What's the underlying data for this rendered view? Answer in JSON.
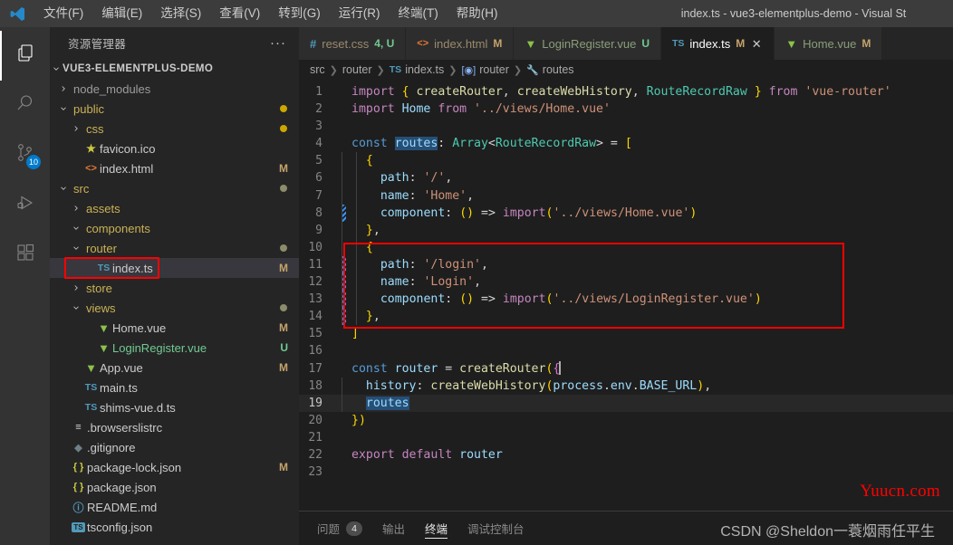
{
  "window": {
    "title": "index.ts - vue3-elementplus-demo - Visual St",
    "logo": "vscode-logo"
  },
  "menu": {
    "items": [
      {
        "label": "文件(F)"
      },
      {
        "label": "编辑(E)"
      },
      {
        "label": "选择(S)"
      },
      {
        "label": "查看(V)"
      },
      {
        "label": "转到(G)"
      },
      {
        "label": "运行(R)"
      },
      {
        "label": "终端(T)"
      },
      {
        "label": "帮助(H)"
      }
    ]
  },
  "activitybar": {
    "items": [
      {
        "name": "explorer",
        "icon": "files-icon",
        "active": true,
        "badge": ""
      },
      {
        "name": "search",
        "icon": "search-icon",
        "active": false,
        "badge": ""
      },
      {
        "name": "source-control",
        "icon": "source-control-icon",
        "active": false,
        "badge": "10"
      },
      {
        "name": "run-debug",
        "icon": "run-debug-icon",
        "active": false,
        "badge": ""
      },
      {
        "name": "extensions",
        "icon": "extensions-icon",
        "active": false,
        "badge": ""
      }
    ]
  },
  "sidebar": {
    "title": "资源管理器",
    "more_label": "···",
    "root": "VUE3-ELEMENTPLUS-DEMO",
    "tree": [
      {
        "label": "node_modules",
        "type": "folder",
        "expanded": false,
        "indent": 1,
        "status": "",
        "dot": ""
      },
      {
        "label": "public",
        "type": "folder",
        "expanded": true,
        "indent": 1,
        "status": "",
        "dot": "#cca700"
      },
      {
        "label": "css",
        "type": "folder",
        "expanded": false,
        "indent": 2,
        "status": "",
        "dot": "#cca700"
      },
      {
        "label": "favicon.ico",
        "type": "ico",
        "indent": 2,
        "status": "",
        "dot": ""
      },
      {
        "label": "index.html",
        "type": "html",
        "indent": 2,
        "status": "M",
        "dot": ""
      },
      {
        "label": "src",
        "type": "folder",
        "expanded": true,
        "indent": 1,
        "status": "",
        "dot": "#8c8c6b"
      },
      {
        "label": "assets",
        "type": "folder",
        "expanded": false,
        "indent": 2,
        "status": "",
        "dot": ""
      },
      {
        "label": "components",
        "type": "folder",
        "expanded": true,
        "indent": 2,
        "status": "",
        "dot": ""
      },
      {
        "label": "router",
        "type": "folder",
        "expanded": true,
        "indent": 2,
        "status": "",
        "dot": "#8c8c6b"
      },
      {
        "label": "index.ts",
        "type": "ts",
        "indent": 3,
        "status": "M",
        "dot": "",
        "selected": true,
        "annotated": true
      },
      {
        "label": "store",
        "type": "folder",
        "expanded": false,
        "indent": 2,
        "status": "",
        "dot": ""
      },
      {
        "label": "views",
        "type": "folder",
        "expanded": true,
        "indent": 2,
        "status": "",
        "dot": "#8c8c6b"
      },
      {
        "label": "Home.vue",
        "type": "vue",
        "indent": 3,
        "status": "M",
        "dot": ""
      },
      {
        "label": "LoginRegister.vue",
        "type": "vue",
        "indent": 3,
        "status": "U",
        "dot": "",
        "untracked": true
      },
      {
        "label": "App.vue",
        "type": "vue",
        "indent": 2,
        "status": "M",
        "dot": ""
      },
      {
        "label": "main.ts",
        "type": "ts",
        "indent": 2,
        "status": "",
        "dot": ""
      },
      {
        "label": "shims-vue.d.ts",
        "type": "ts",
        "indent": 2,
        "status": "",
        "dot": ""
      },
      {
        "label": ".browserslistrc",
        "type": "config",
        "indent": 1,
        "status": "",
        "dot": ""
      },
      {
        "label": ".gitignore",
        "type": "git",
        "indent": 1,
        "status": "",
        "dot": ""
      },
      {
        "label": "package-lock.json",
        "type": "json",
        "indent": 1,
        "status": "M",
        "dot": ""
      },
      {
        "label": "package.json",
        "type": "json",
        "indent": 1,
        "status": "",
        "dot": ""
      },
      {
        "label": "README.md",
        "type": "md",
        "indent": 1,
        "status": "",
        "dot": ""
      },
      {
        "label": "tsconfig.json",
        "type": "tsconfig",
        "indent": 1,
        "status": "",
        "dot": ""
      }
    ]
  },
  "tabs": [
    {
      "label": "reset.css",
      "icon": "css-icon",
      "status": "4, U",
      "active": false,
      "closable": false
    },
    {
      "label": "index.html",
      "icon": "html-icon",
      "status": "M",
      "active": false,
      "closable": false
    },
    {
      "label": "LoginRegister.vue",
      "icon": "vue-icon",
      "status": "U",
      "active": false,
      "closable": false
    },
    {
      "label": "index.ts",
      "icon": "ts-icon",
      "status": "M",
      "active": true,
      "closable": true,
      "close_glyph": "✕"
    },
    {
      "label": "Home.vue",
      "icon": "vue-icon",
      "status": "M",
      "active": false,
      "closable": false
    }
  ],
  "breadcrumb": [
    {
      "label": "src",
      "icon": ""
    },
    {
      "label": "router",
      "icon": ""
    },
    {
      "label": "index.ts",
      "icon": "ts-icon"
    },
    {
      "label": "router",
      "icon": "module-icon"
    },
    {
      "label": "routes",
      "icon": "property-icon"
    }
  ],
  "code": {
    "lines": [
      {
        "n": 1,
        "text": "import { createRouter, createWebHistory, RouteRecordRaw } from 'vue-router'"
      },
      {
        "n": 2,
        "text": "import Home from '../views/Home.vue'"
      },
      {
        "n": 3,
        "text": ""
      },
      {
        "n": 4,
        "text": "const routes: Array<RouteRecordRaw> = ["
      },
      {
        "n": 5,
        "text": "  {"
      },
      {
        "n": 6,
        "text": "    path: '/',"
      },
      {
        "n": 7,
        "text": "    name: 'Home',"
      },
      {
        "n": 8,
        "text": "    component: () => import('../views/Home.vue')"
      },
      {
        "n": 9,
        "text": "  },"
      },
      {
        "n": 10,
        "text": "  {"
      },
      {
        "n": 11,
        "text": "    path: '/login',"
      },
      {
        "n": 12,
        "text": "    name: 'Login',"
      },
      {
        "n": 13,
        "text": "    component: () => import('../views/LoginRegister.vue')"
      },
      {
        "n": 14,
        "text": "  },"
      },
      {
        "n": 15,
        "text": "]"
      },
      {
        "n": 16,
        "text": ""
      },
      {
        "n": 17,
        "text": "const router = createRouter({"
      },
      {
        "n": 18,
        "text": "  history: createWebHistory(process.env.BASE_URL),"
      },
      {
        "n": 19,
        "text": "  routes"
      },
      {
        "n": 20,
        "text": "})"
      },
      {
        "n": 21,
        "text": ""
      },
      {
        "n": 22,
        "text": "export default router"
      },
      {
        "n": 23,
        "text": ""
      }
    ],
    "current_line": 19,
    "selected_word": "routes",
    "diff_added_lines": [
      8,
      11,
      12,
      13,
      14
    ],
    "annotation_box_lines": [
      10,
      14
    ]
  },
  "panel": {
    "tabs": [
      {
        "label": "问题",
        "badge": "4",
        "active": false
      },
      {
        "label": "输出",
        "badge": "",
        "active": false
      },
      {
        "label": "终端",
        "badge": "",
        "active": true
      },
      {
        "label": "调试控制台",
        "badge": "",
        "active": false
      }
    ]
  },
  "watermarks": {
    "yuucn": "Yuucn.com",
    "csdn": "CSDN @Sheldon一蓑烟雨任平生"
  },
  "colors": {
    "annotation": "#ff0000",
    "accent": "#007acc",
    "selection": "#264f78"
  }
}
